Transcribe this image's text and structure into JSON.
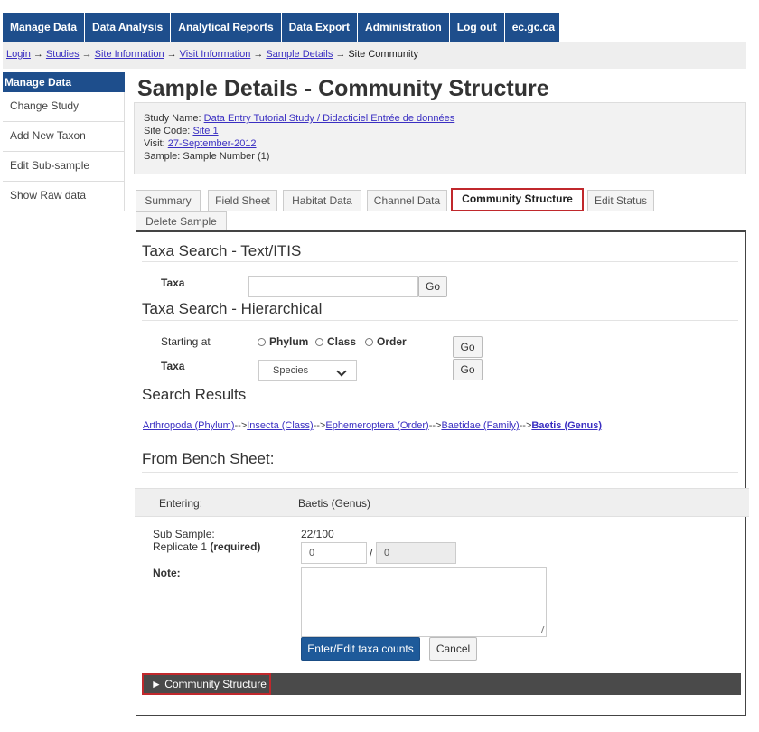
{
  "topnav": {
    "items": [
      "Manage Data",
      "Data Analysis",
      "Analytical Reports",
      "Data Export",
      "Administration",
      "Log out",
      "ec.gc.ca"
    ]
  },
  "breadcrumb": {
    "items": [
      "Login",
      "Studies",
      "Site Information",
      "Visit Information",
      "Sample Details"
    ],
    "current": "Site Community",
    "separator": "→"
  },
  "sidebar": {
    "heading": "Manage Data",
    "items": [
      "Change Study",
      "Add New Taxon",
      "Edit Sub-sample",
      "Show Raw data"
    ]
  },
  "page": {
    "title": "Sample Details - Community Structure"
  },
  "info": {
    "study_label": "Study Name:",
    "study_value": "Data Entry Tutorial Study / Didacticiel Entrée de données",
    "site_label": "Site Code:",
    "site_value": "Site 1",
    "visit_label": "Visit:",
    "visit_value": "27-September-2012",
    "sample_text": "Sample: Sample Number (1)"
  },
  "tabs": [
    "Summary",
    "Field Sheet",
    "Habitat Data",
    "Channel Data",
    "Community Structure",
    "Edit Status",
    "Delete Sample"
  ],
  "active_tab": "Community Structure",
  "text_search": {
    "heading": "Taxa Search - Text/ITIS",
    "taxa_label": "Taxa",
    "input_value": "",
    "go_label": "Go"
  },
  "hier_search": {
    "heading": "Taxa Search - Hierarchical",
    "starting_label": "Starting at",
    "options": [
      "Phylum",
      "Class",
      "Order"
    ],
    "taxa_label": "Taxa",
    "select_value": "Species",
    "go_label": "Go"
  },
  "results": {
    "heading": "Search Results",
    "path": [
      "Arthropoda (Phylum)",
      "Insecta (Class)",
      "Ephemeroptera (Order)",
      "Baetidae (Family)",
      "Baetis (Genus)"
    ],
    "separator": "-->"
  },
  "bench": {
    "heading": "From Bench Sheet:",
    "entering_label": "Entering:",
    "entering_value": "Baetis (Genus)",
    "subsample_label": "Sub Sample:",
    "subsample_value": "22/100",
    "replicate_label": "Replicate 1",
    "required_text": "(required)",
    "replicate_value": "0",
    "replicate_total": "0",
    "slash": "/",
    "note_label": "Note:",
    "submit_label": "Enter/Edit taxa counts",
    "cancel_label": "Cancel"
  },
  "accordion": {
    "label": "► Community Structure"
  }
}
